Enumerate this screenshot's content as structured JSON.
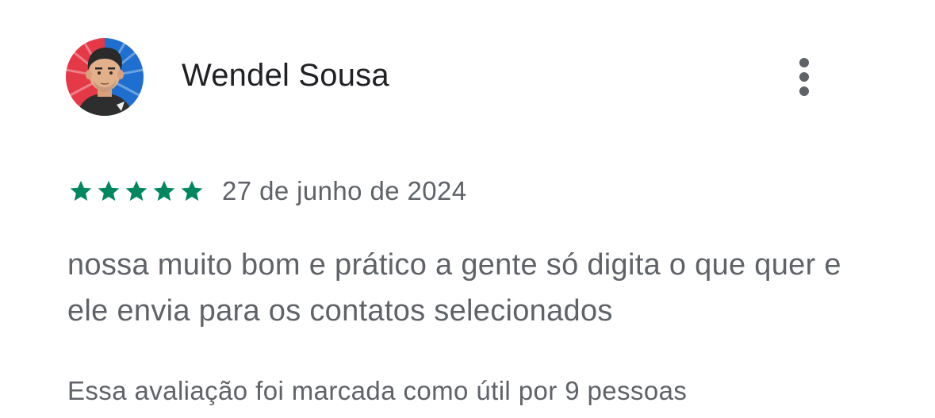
{
  "review": {
    "reviewer_name": "Wendel Sousa",
    "more_icon": "more-vert-icon",
    "rating": {
      "stars": 5,
      "max": 5,
      "color": "#01875f",
      "icon": "star-icon"
    },
    "date": "27 de junho de 2024",
    "text": "nossa muito bom e prático a gente só digita o que quer e ele envia para os contatos selecionados",
    "helpful": "Essa avaliação foi marcada como útil por 9 pessoas"
  }
}
